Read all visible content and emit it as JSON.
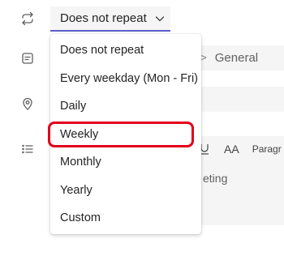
{
  "repeat": {
    "selected": "Does not repeat",
    "options": [
      "Does not repeat",
      "Every weekday (Mon - Fri)",
      "Daily",
      "Weekly",
      "Monthly",
      "Yearly",
      "Custom"
    ],
    "highlighted": "Weekly",
    "highlight_color": "#e2001a"
  },
  "background": {
    "channel_separator": ">",
    "channel_name": "General",
    "toolbar_font_size_label": "AA",
    "toolbar_paragraph_label": "Paragr",
    "editor_placeholder": "eting"
  },
  "colors": {
    "accent": "#5b5fc7",
    "field_bg": "#f5f5f5"
  }
}
